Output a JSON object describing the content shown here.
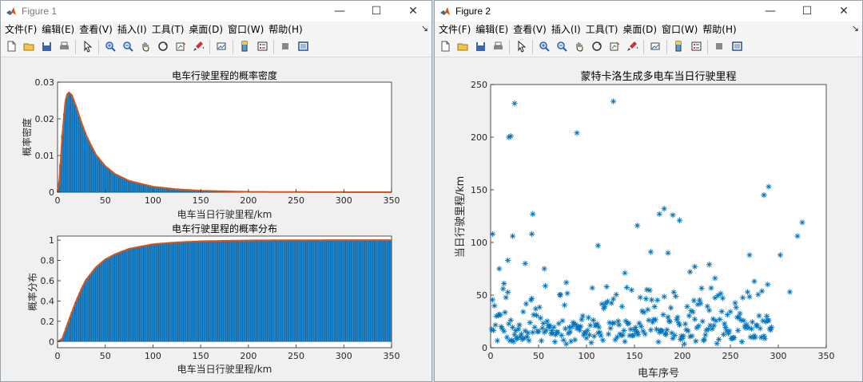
{
  "colors": {
    "bar_fill": "#1b8ad6",
    "bar_edge": "#0b3a5e",
    "curve": "#d95319",
    "star": "#0072bd",
    "axes_bg": "#ffffff",
    "figure_bg": "#f0f0f0"
  },
  "window_controls": {
    "minimize": "—",
    "maximize": "☐",
    "close": "✕"
  },
  "menu": [
    "文件(F)",
    "编辑(E)",
    "查看(V)",
    "插入(I)",
    "工具(T)",
    "桌面(D)",
    "窗口(W)",
    "帮助(H)"
  ],
  "toolbar_icons": [
    "new-file-icon",
    "open-folder-icon",
    "save-icon",
    "print-icon",
    "sep",
    "pointer-icon",
    "sep",
    "zoom-in-icon",
    "zoom-out-icon",
    "pan-hand-icon",
    "rotate-3d-icon",
    "data-cursor-icon",
    "brush-icon",
    "sep",
    "link-plot-icon",
    "sep",
    "colorbar-icon",
    "legend-icon",
    "sep",
    "hide-plot-tools-icon",
    "show-plot-tools-icon"
  ],
  "figure1": {
    "title": "Figure 1",
    "pdf_plot": {
      "title": "电车行驶里程的概率密度",
      "xlabel": "电车当日行驶里程/km",
      "ylabel": "概率密度",
      "xticks": [
        "0",
        "50",
        "100",
        "150",
        "200",
        "250",
        "300",
        "350"
      ],
      "yticks": [
        "0",
        "0.01",
        "0.02",
        "0.03"
      ]
    },
    "cdf_plot": {
      "title": "电车行驶里程的概率分布",
      "xlabel": "电车当日行驶里程/km",
      "ylabel": "概率分布",
      "xticks": [
        "0",
        "50",
        "100",
        "150",
        "200",
        "250",
        "300",
        "350"
      ],
      "yticks": [
        "0",
        "0.2",
        "0.4",
        "0.6",
        "0.8",
        "1"
      ]
    }
  },
  "figure2": {
    "title": "Figure 2",
    "scatter_plot": {
      "title": "蒙特卡洛生成多电车当日行驶里程",
      "xlabel": "电车序号",
      "ylabel": "当日行驶里程/km",
      "xticks": [
        "0",
        "50",
        "100",
        "150",
        "200",
        "250",
        "300",
        "350"
      ],
      "yticks": [
        "0",
        "50",
        "100",
        "150",
        "200",
        "250"
      ]
    }
  },
  "chart_data": [
    {
      "type": "bar",
      "title": "电车行驶里程的概率密度",
      "xlabel": "电车当日行驶里程/km",
      "ylabel": "概率密度",
      "xlim": [
        0,
        350
      ],
      "ylim": [
        0,
        0.03
      ],
      "distribution": "lognormal",
      "mode_x": 12,
      "peak_density": 0.0272,
      "curve_points": [
        [
          0,
          0
        ],
        [
          2,
          0.0035
        ],
        [
          5,
          0.0155
        ],
        [
          8,
          0.0243
        ],
        [
          10,
          0.0266
        ],
        [
          12,
          0.0272
        ],
        [
          15,
          0.0265
        ],
        [
          20,
          0.023
        ],
        [
          25,
          0.019
        ],
        [
          30,
          0.0155
        ],
        [
          40,
          0.0103
        ],
        [
          50,
          0.0071
        ],
        [
          60,
          0.005
        ],
        [
          75,
          0.0031
        ],
        [
          100,
          0.0015
        ],
        [
          125,
          0.0008
        ],
        [
          150,
          0.0004
        ],
        [
          200,
          0.0001
        ],
        [
          250,
          4e-05
        ],
        [
          300,
          1e-05
        ],
        [
          350,
          0
        ]
      ]
    },
    {
      "type": "bar",
      "title": "电车行驶里程的概率分布",
      "xlabel": "电车当日行驶里程/km",
      "ylabel": "概率分布",
      "xlim": [
        0,
        350
      ],
      "ylim": [
        0,
        1
      ],
      "curve_points": [
        [
          0,
          0
        ],
        [
          5,
          0.03
        ],
        [
          10,
          0.16
        ],
        [
          15,
          0.29
        ],
        [
          20,
          0.41
        ],
        [
          25,
          0.52
        ],
        [
          30,
          0.61
        ],
        [
          40,
          0.73
        ],
        [
          50,
          0.81
        ],
        [
          60,
          0.86
        ],
        [
          75,
          0.915
        ],
        [
          100,
          0.96
        ],
        [
          125,
          0.978
        ],
        [
          150,
          0.989
        ],
        [
          200,
          0.997
        ],
        [
          250,
          0.999
        ],
        [
          300,
          1
        ],
        [
          350,
          1
        ]
      ]
    },
    {
      "type": "scatter",
      "title": "蒙特卡洛生成多电车当日行驶里程",
      "xlabel": "电车序号",
      "ylabel": "当日行驶里程/km",
      "xlim": [
        0,
        350
      ],
      "ylim": [
        0,
        250
      ],
      "n_points": 330,
      "highlighted_points": [
        [
          2,
          108
        ],
        [
          19,
          200
        ],
        [
          21,
          201
        ],
        [
          25,
          232
        ],
        [
          23,
          106
        ],
        [
          43,
          108
        ],
        [
          44,
          127
        ],
        [
          90,
          204
        ],
        [
          112,
          97
        ],
        [
          128,
          234
        ],
        [
          153,
          116
        ],
        [
          176,
          127
        ],
        [
          181,
          132
        ],
        [
          190,
          126
        ],
        [
          197,
          121
        ],
        [
          285,
          145
        ],
        [
          290,
          153
        ],
        [
          320,
          106
        ],
        [
          325,
          119
        ],
        [
          270,
          88
        ],
        [
          9,
          75
        ],
        [
          14,
          61
        ],
        [
          18,
          83
        ],
        [
          36,
          80
        ],
        [
          56,
          75
        ],
        [
          79,
          62
        ],
        [
          140,
          71
        ],
        [
          167,
          91
        ],
        [
          185,
          90
        ],
        [
          208,
          72
        ],
        [
          213,
          77
        ],
        [
          228,
          79
        ],
        [
          234,
          66
        ],
        [
          275,
          63
        ],
        [
          289,
          60
        ],
        [
          302,
          88
        ],
        [
          312,
          53
        ]
      ]
    }
  ]
}
